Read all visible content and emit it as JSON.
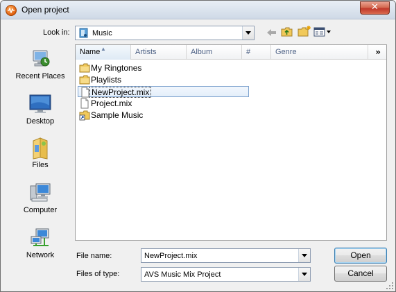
{
  "window": {
    "title": "Open project",
    "close_label": "✕"
  },
  "lookin": {
    "label": "Look in:",
    "value": "Music"
  },
  "toolbar": {
    "icons": [
      "back-arrow-icon",
      "up-folder-icon",
      "new-folder-icon",
      "view-menu-icon"
    ]
  },
  "places": [
    {
      "label": "Recent Places",
      "icon": "recent-places-icon"
    },
    {
      "label": "Desktop",
      "icon": "desktop-icon"
    },
    {
      "label": "Files",
      "icon": "files-icon"
    },
    {
      "label": "Computer",
      "icon": "computer-icon"
    },
    {
      "label": "Network",
      "icon": "network-icon"
    }
  ],
  "columns": [
    "Name",
    "Artists",
    "Album",
    "#",
    "Genre"
  ],
  "more_columns": "»",
  "files": [
    {
      "name": "My Ringtones",
      "type": "folder"
    },
    {
      "name": "Playlists",
      "type": "folder"
    },
    {
      "name": "NewProject.mix",
      "type": "file",
      "selected": true
    },
    {
      "name": "Project.mix",
      "type": "file"
    },
    {
      "name": "Sample Music",
      "type": "shortcut"
    }
  ],
  "filename": {
    "label": "File name:",
    "value": "NewProject.mix"
  },
  "filetype": {
    "label": "Files of type:",
    "value": "AVS Music Mix Project"
  },
  "buttons": {
    "open": "Open",
    "cancel": "Cancel"
  }
}
